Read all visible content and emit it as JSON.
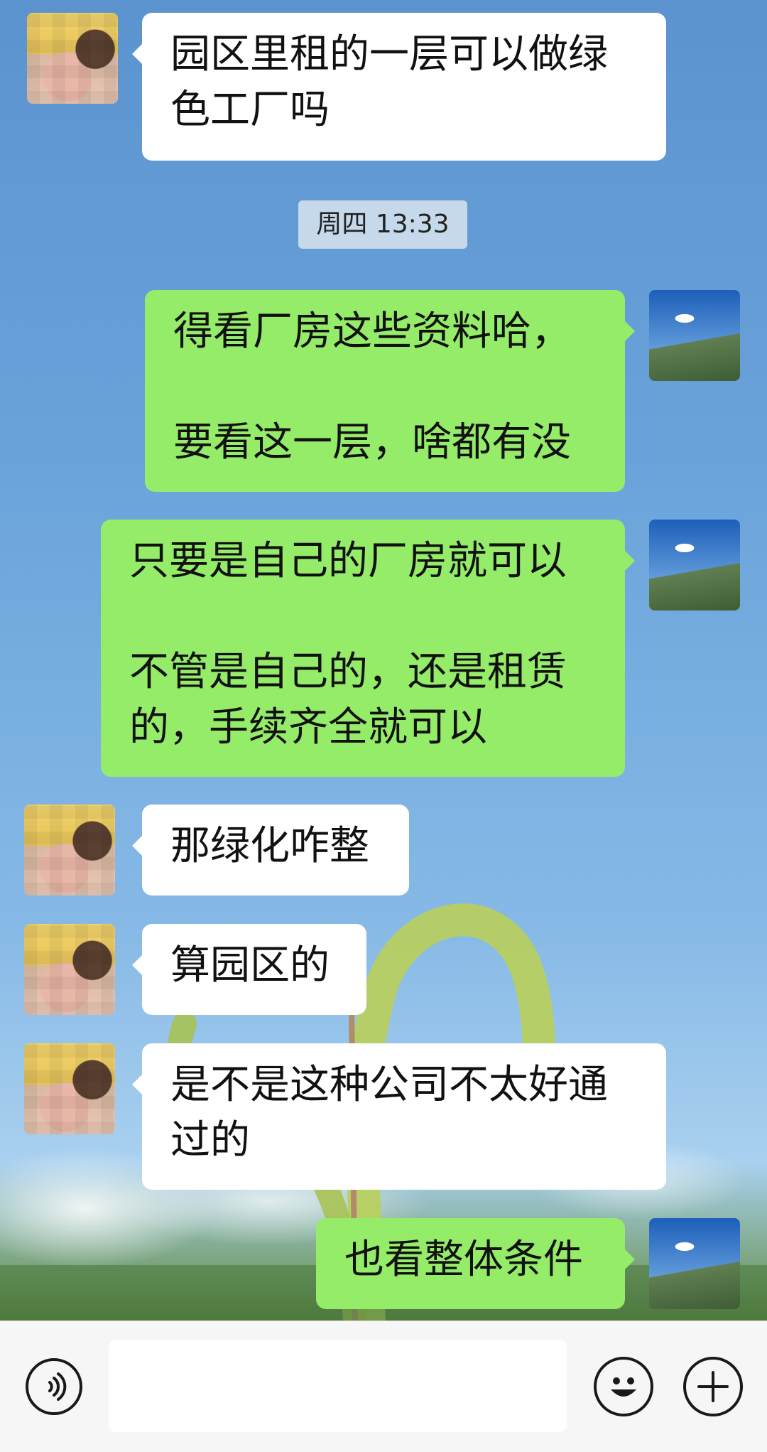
{
  "chat": {
    "timestamp": "周四 13:33",
    "messages": [
      {
        "side": "in",
        "text": "园区里租的一层可以做绿\n色工厂吗"
      },
      {
        "side": "out",
        "text": "得看厂房这些资料哈，\n\n要看这一层，啥都有没"
      },
      {
        "side": "out",
        "text": "只要是自己的厂房就可以\n\n不管是自己的，还是租赁\n的，手续齐全就可以"
      },
      {
        "side": "in",
        "text": "那绿化咋整"
      },
      {
        "side": "in",
        "text": "算园区的"
      },
      {
        "side": "in",
        "text": "是不是这种公司不太好通\n过的"
      },
      {
        "side": "out",
        "text": "也看整体条件"
      }
    ]
  },
  "input_bar": {
    "voice_icon": "voice-icon",
    "emoji_icon": "emoji-icon",
    "plus_icon": "plus-icon",
    "input_value": ""
  },
  "colors": {
    "outgoing_bubble": "#95ec69",
    "incoming_bubble": "#ffffff",
    "input_bar_bg": "#f6f6f6"
  }
}
